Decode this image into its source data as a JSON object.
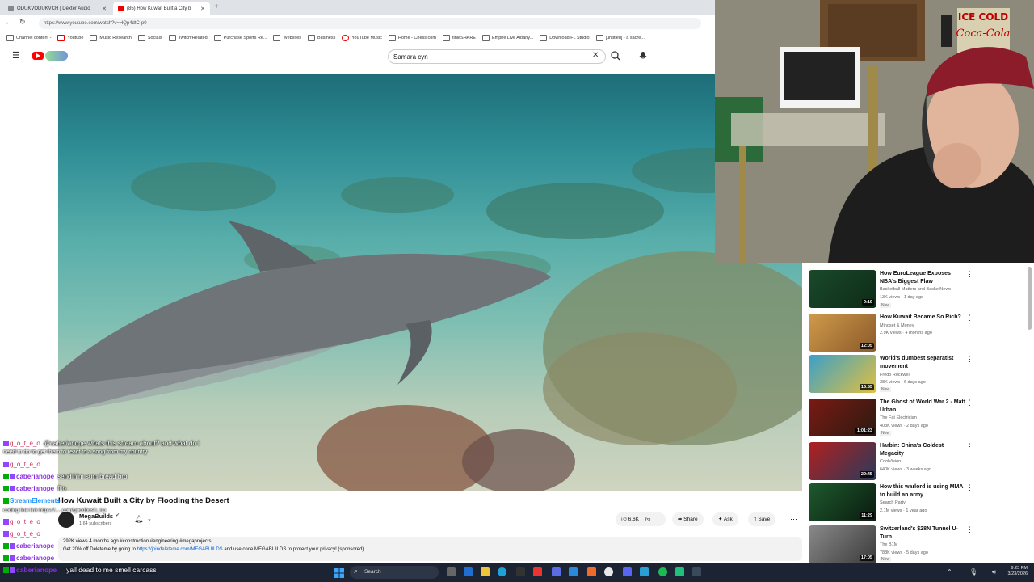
{
  "browser": {
    "tabs": [
      {
        "label": "ODUKVODUKVCH | Dexter Audio"
      },
      {
        "label": "(85) How Kuwait Built a City b"
      }
    ],
    "url": "https://www.youtube.com/watch?v=HQp4dtC-p0",
    "bookmarks": [
      "Channel content -",
      "Youtube",
      "Music Research",
      "Socials",
      "Twitch/Related",
      "Purchase Sports Re...",
      "Websites",
      "Business",
      "YouTube Music",
      "Home - Chess.com",
      "tinieSHARE",
      "Empire Live Albany...",
      "Download FL Studio",
      "[untitled] - a sacre..."
    ]
  },
  "youtube": {
    "search_value": "Samara cyn",
    "video_title": "How Kuwait Built a City by Flooding the Desert",
    "channel_name": "MegaBuilds",
    "subscribers": "1.64 subscribers",
    "likes": "6.6K",
    "share_label": "Share",
    "ask_label": "Ask",
    "save_label": "Save",
    "desc_stats": "292K views  4 months ago  #construction #engineering #megaprojects",
    "desc_text_a": "Get 20% off Deleteme by going to",
    "desc_link": "https://joindeleteme.com/MEGABUILDS",
    "desc_text_b": "and use code MEGABUILDS to protect your privacy! (sponsored)"
  },
  "recommendations": [
    {
      "title": "How EuroLeague Exposes NBA's Biggest Flaw",
      "channel": "Basketball Matters and BasketNews",
      "meta": "13K views · 1 day ago",
      "badge": "New",
      "duration": "9:19",
      "color": "#1a4a2a"
    },
    {
      "title": "How Kuwait Became So Rich?",
      "channel": "Mindset & Money",
      "meta": "2.9K views · 4 months ago",
      "badge": "",
      "duration": "12:05",
      "color": "#c48a3a"
    },
    {
      "title": "World's dumbest separatist movement",
      "channel": "Fredo Rockwell",
      "meta": "38K views · 6 days ago",
      "badge": "New",
      "duration": "16:55",
      "color": "#3aa0c8"
    },
    {
      "title": "The Ghost of World War 2 - Matt Urban",
      "channel": "The Fat Electrician",
      "meta": "403K views · 2 days ago",
      "badge": "New",
      "duration": "1:01:23",
      "color": "#7a1a14"
    },
    {
      "title": "Harbin: China's Coldest Megacity",
      "channel": "CoolVision",
      "meta": "640K views · 3 weeks ago",
      "badge": "",
      "duration": "29:45",
      "color": "#b02020"
    },
    {
      "title": "How this warlord is using MMA to build an army",
      "channel": "Search Party",
      "meta": "2.1M views · 1 year ago",
      "badge": "",
      "duration": "11:29",
      "color": "#1e5a2e"
    },
    {
      "title": "Switzerland's $28N Tunnel U-Turn",
      "channel": "The B1M",
      "meta": "788K views · 5 days ago",
      "badge": "New",
      "duration": "17:05",
      "color": "#6a6a6a"
    }
  ],
  "chat": [
    {
      "user": "g_o_t_e_o",
      "message": "@caberianope whats this stream about? and what do i",
      "style": "u1"
    },
    {
      "user": "",
      "message": "need to do to get them to react to a song from my country",
      "style": "cont"
    },
    {
      "user": "g_o_t_e_o",
      "message": "",
      "style": "u1"
    },
    {
      "user": "caberianope",
      "message": "send him sum bread bro",
      "style": "u2"
    },
    {
      "user": "caberianope",
      "message": "fito",
      "style": "u2"
    },
    {
      "user": "StreamElements",
      "message": "",
      "style": "u3"
    },
    {
      "user": "",
      "message": "coding line link https://.....com/goodbush_rtp",
      "style": "cont"
    },
    {
      "user": "g_o_t_e_o",
      "message": "",
      "style": "u1"
    },
    {
      "user": "g_o_t_e_o",
      "message": "",
      "style": "u1"
    },
    {
      "user": "caberianope",
      "message": "",
      "style": "u2"
    },
    {
      "user": "caberianope",
      "message": "",
      "style": "u2"
    },
    {
      "user": "caberianope",
      "message": "yall dead to me smell carcass",
      "style": "u2"
    }
  ],
  "webcam": {
    "sign_text": "ICE COLD",
    "brand": "Coca-Cola"
  },
  "taskbar": {
    "search_label": "Search",
    "time": "9:23 PM",
    "date": "3/23/2026"
  }
}
